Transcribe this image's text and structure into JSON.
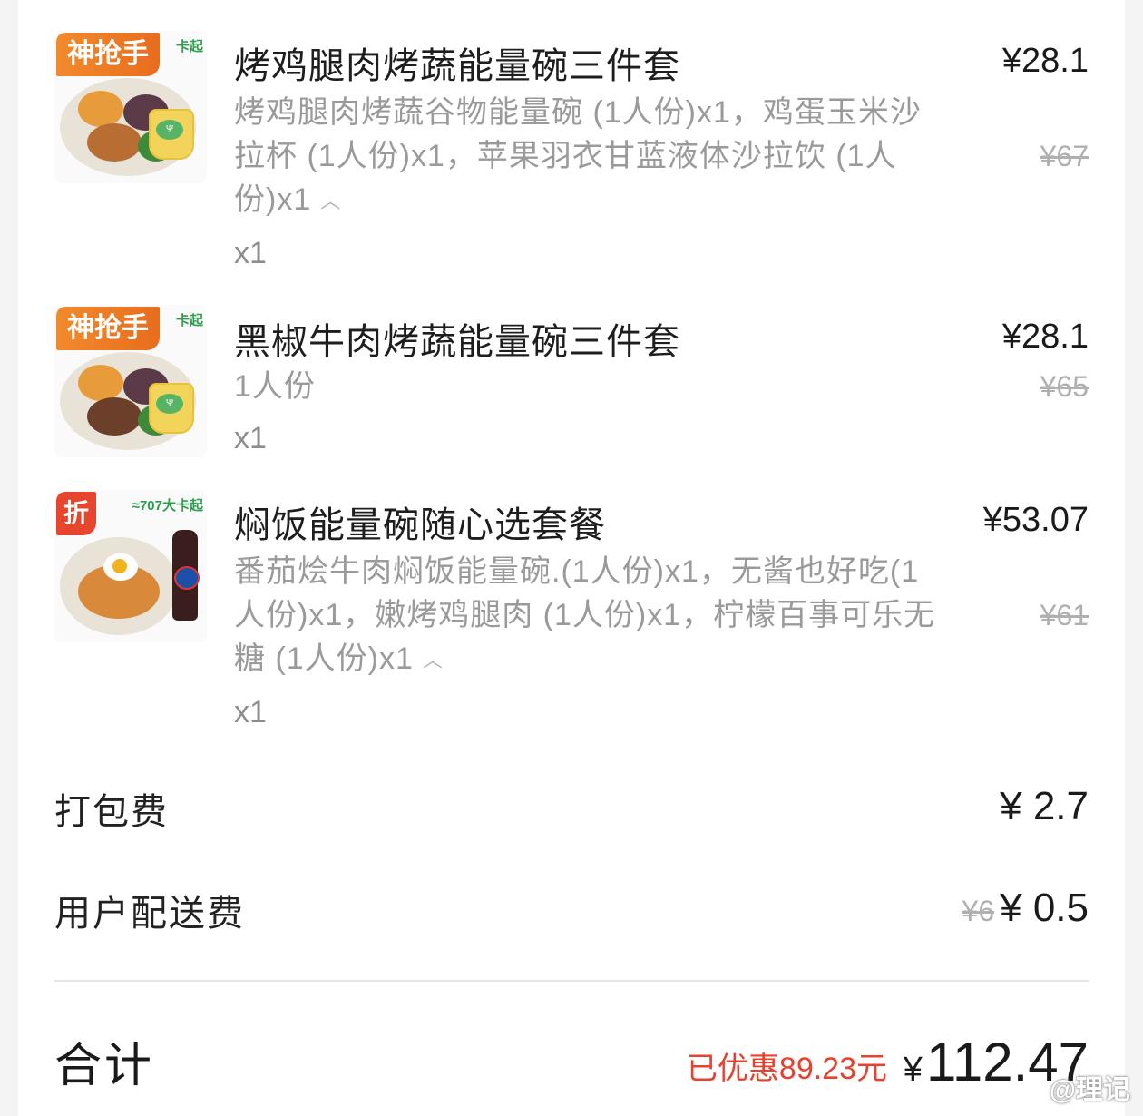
{
  "items": [
    {
      "badge": "神抢手",
      "kcal_tag": "卡起",
      "title": "烤鸡腿肉烤蔬能量碗三件套",
      "desc": "烤鸡腿肉烤蔬谷物能量碗 (1人份)x1，鸡蛋玉米沙拉杯 (1人份)x1，苹果羽衣甘蓝液体沙拉饮 (1人份)x1",
      "qty": "x1",
      "price": "¥28.1",
      "original_price": "¥67"
    },
    {
      "badge": "神抢手",
      "kcal_tag": "卡起",
      "title": "黑椒牛肉烤蔬能量碗三件套",
      "desc": "1人份",
      "qty": "x1",
      "price": "¥28.1",
      "original_price": "¥65"
    },
    {
      "badge": "折",
      "kcal_tag": "≈707大卡起",
      "title": "焖饭能量碗随心选套餐",
      "desc": "番茄烩牛肉焖饭能量碗.(1人份)x1，无酱也好吃(1人份)x1，嫩烤鸡腿肉 (1人份)x1，柠檬百事可乐无糖 (1人份)x1",
      "qty": "x1",
      "price": "¥53.07",
      "original_price": "¥61"
    }
  ],
  "fees": {
    "packing_label": "打包费",
    "packing_value": "¥ 2.7",
    "delivery_label": "用户配送费",
    "delivery_original": "¥6",
    "delivery_value": "¥ 0.5"
  },
  "total": {
    "label": "合计",
    "saved": "已优惠89.23元",
    "currency": "¥",
    "amount": "112.47"
  },
  "watermark": "@理记",
  "colors": {
    "accent_red": "#e8412c",
    "badge_orange": "#ee7b25",
    "muted_text": "#9a9a9a"
  }
}
